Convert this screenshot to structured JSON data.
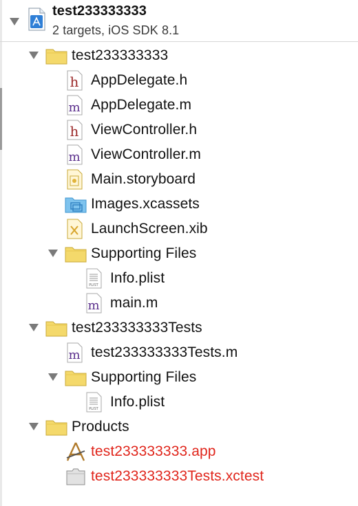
{
  "project": {
    "name": "test233333333",
    "subtitle": "2 targets, iOS SDK 8.1"
  },
  "tree": {
    "group_app": "test233333333",
    "app_delegate_h": "AppDelegate.h",
    "app_delegate_m": "AppDelegate.m",
    "view_controller_h": "ViewController.h",
    "view_controller_m": "ViewController.m",
    "main_storyboard": "Main.storyboard",
    "images_xcassets": "Images.xcassets",
    "launch_screen": "LaunchScreen.xib",
    "supporting_files_1": "Supporting Files",
    "info_plist_1": "Info.plist",
    "main_m": "main.m",
    "group_tests": "test233333333Tests",
    "tests_m": "test233333333Tests.m",
    "supporting_files_2": "Supporting Files",
    "info_plist_2": "Info.plist",
    "group_products": "Products",
    "product_app": "test233333333.app",
    "product_xctest": "test233333333Tests.xctest"
  },
  "icons": {
    "h_letter": "h",
    "m_letter": "m",
    "plist_tag": "PLIST"
  },
  "colors": {
    "folder_fill": "#f4d96b",
    "folder_stroke": "#c9a93a",
    "missing_product_red": "#e0251b",
    "xcassets_blue": "#5ab0e6",
    "project_blue": "#2f7fd6"
  }
}
